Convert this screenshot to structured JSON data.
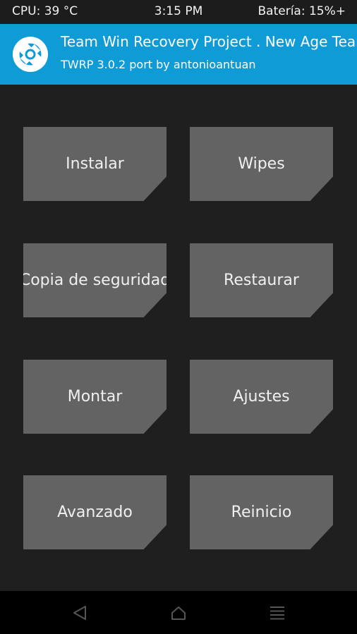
{
  "status_bar": {
    "cpu": "CPU: 39 °C",
    "time": "3:15 PM",
    "battery": "Batería: 15%+"
  },
  "header": {
    "title": "Team Win Recovery Project . New Age Team",
    "subtitle": "TWRP 3.0.2 port by antonioantuan",
    "logo_icon": "twrp-logo-icon"
  },
  "menu": {
    "buttons": [
      {
        "label": "Instalar"
      },
      {
        "label": "Wipes"
      },
      {
        "label": "Copia de seguridad"
      },
      {
        "label": "Restaurar"
      },
      {
        "label": "Montar"
      },
      {
        "label": "Ajustes"
      },
      {
        "label": "Avanzado"
      },
      {
        "label": "Reinicio"
      }
    ]
  },
  "nav_bar": {
    "back_icon": "back-triangle-icon",
    "home_icon": "home-icon",
    "menu_icon": "menu-lines-icon"
  },
  "colors": {
    "background": "#1f1f1f",
    "header": "#0e9bd6",
    "button": "#636363",
    "nav_bar": "#000000",
    "nav_icon": "#555555"
  }
}
